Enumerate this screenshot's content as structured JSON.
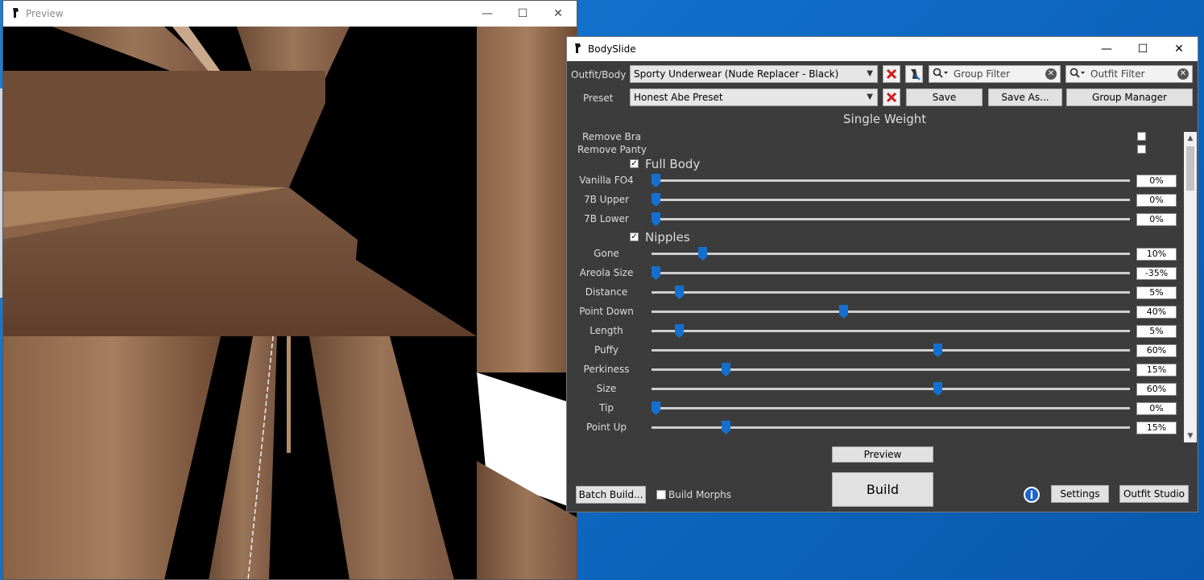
{
  "preview_window": {
    "title": "Preview",
    "controls": {
      "minimize": "—",
      "maximize": "☐",
      "close": "✕"
    }
  },
  "bodyslide": {
    "title": "BodySlide",
    "controls": {
      "minimize": "—",
      "maximize": "☐",
      "close": "✕"
    },
    "outfit_label": "Outfit/Body",
    "outfit_value": "Sporty Underwear (Nude Replacer - Black)",
    "preset_label": "Preset",
    "preset_value": "Honest Abe Preset",
    "group_filter_placeholder": "Group Filter",
    "outfit_filter_placeholder": "Outfit Filter",
    "save_label": "Save",
    "save_as_label": "Save As...",
    "group_manager_label": "Group Manager",
    "weight_title": "Single Weight",
    "remove_bra_label": "Remove Bra",
    "remove_panty_label": "Remove Panty",
    "remove_bra_checked": false,
    "remove_panty_checked": false,
    "full_body_label": "Full Body",
    "full_body_checked": true,
    "nipples_label": "Nipples",
    "nipples_checked": true,
    "full_body_sliders": [
      {
        "label": "Vanilla FO4",
        "value": "0%",
        "level": 0
      },
      {
        "label": "7B Upper",
        "value": "0%",
        "level": 0
      },
      {
        "label": "7B Lower",
        "value": "0%",
        "level": 0
      }
    ],
    "nipple_sliders": [
      {
        "label": "Gone",
        "value": "10%",
        "level": 10
      },
      {
        "label": "Areola Size",
        "value": "-35%",
        "level": 0
      },
      {
        "label": "Distance",
        "value": "5%",
        "level": 5
      },
      {
        "label": "Point Down",
        "value": "40%",
        "level": 40
      },
      {
        "label": "Length",
        "value": "5%",
        "level": 5
      },
      {
        "label": "Puffy",
        "value": "60%",
        "level": 60
      },
      {
        "label": "Perkiness",
        "value": "15%",
        "level": 15
      },
      {
        "label": "Size",
        "value": "60%",
        "level": 60
      },
      {
        "label": "Tip",
        "value": "0%",
        "level": 0
      },
      {
        "label": "Point Up",
        "value": "15%",
        "level": 15
      }
    ],
    "preview_button": "Preview",
    "build_button": "Build",
    "batch_build_button": "Batch Build...",
    "build_morphs_label": "Build Morphs",
    "build_morphs_checked": false,
    "info_button": "i",
    "settings_button": "Settings",
    "outfit_studio_button": "Outfit Studio",
    "accent_color": "#1470d0",
    "remove_color": "#d11a1a"
  }
}
